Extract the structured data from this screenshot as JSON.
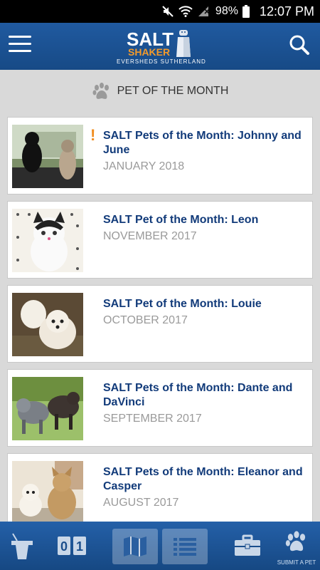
{
  "status": {
    "battery": "98%",
    "time": "12:07 PM"
  },
  "header": {
    "logo": {
      "salt": "SALT",
      "shaker": "SHAKER",
      "sub": "EVERSHEDS SUTHERLAND"
    }
  },
  "section": {
    "title": "PET OF THE MONTH"
  },
  "items": [
    {
      "title": "SALT Pets of the Month: Johnny and June",
      "date": "JANUARY 2018",
      "flag": "!"
    },
    {
      "title": "SALT Pet of the Month: Leon",
      "date": "NOVEMBER 2017"
    },
    {
      "title": "SALT Pet of the Month: Louie",
      "date": "OCTOBER 2017"
    },
    {
      "title": "SALT Pets of the Month: Dante and DaVinci",
      "date": "SEPTEMBER 2017"
    },
    {
      "title": "SALT Pets of the Month: Eleanor and Casper",
      "date": "AUGUST 2017"
    }
  ],
  "bottom_nav": {
    "submit_label": "SUBMIT A PET",
    "counter": "01"
  }
}
